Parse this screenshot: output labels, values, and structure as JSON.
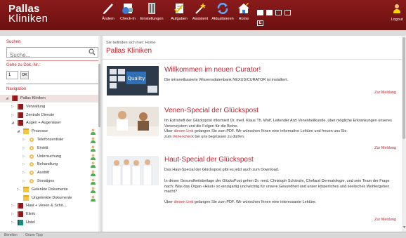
{
  "app": {
    "logo_line1": "Pallas",
    "logo_line2": "Kliniken"
  },
  "toolbar": {
    "items": [
      {
        "label": "Ändern",
        "icon": "pencil-icon"
      },
      {
        "label": "Check-In",
        "icon": "check-in-icon"
      },
      {
        "label": "Einstellungen",
        "icon": "settings-icon"
      },
      {
        "label": "Aufgaben",
        "icon": "tasks-icon"
      },
      {
        "label": "Assistent",
        "icon": "wizard-icon"
      },
      {
        "label": "Aktualisieren",
        "icon": "refresh-icon"
      },
      {
        "label": "Home",
        "icon": "home-icon"
      }
    ],
    "layout_e": "E",
    "logout_label": "Logout"
  },
  "sidebar": {
    "search_label": "Suchen",
    "search_placeholder": "Suche...",
    "docnr_label": "Gehe zu Dok.-Nr.:",
    "docnr_value": "1",
    "ok_label": "OK",
    "nav_label": "Navigation",
    "tree": [
      {
        "label": "Pallas Kliniken",
        "icon": "book-red",
        "level": 0,
        "arrow": "◢",
        "selected": true,
        "user": false
      },
      {
        "label": "Verwaltung",
        "icon": "book-red",
        "level": 1,
        "arrow": "▷",
        "user": false
      },
      {
        "label": "Zentrale Dienste",
        "icon": "book-red",
        "level": 1,
        "arrow": "▷",
        "user": false
      },
      {
        "label": "Augen + Augenlaser",
        "icon": "book-red",
        "level": 1,
        "arrow": "◢",
        "user": false
      },
      {
        "label": "Prozesse",
        "icon": "folder",
        "level": 2,
        "arrow": "◢",
        "user": true
      },
      {
        "label": "Telefonzentrale",
        "icon": "gear",
        "level": 3,
        "arrow": "▷",
        "user": true
      },
      {
        "label": "Eintritt",
        "icon": "gear",
        "level": 3,
        "arrow": "▷",
        "user": true
      },
      {
        "label": "Untersuchung",
        "icon": "gear",
        "level": 3,
        "arrow": "▷",
        "user": true
      },
      {
        "label": "Behandlung",
        "icon": "gear",
        "level": 3,
        "arrow": "▷",
        "user": true
      },
      {
        "label": "Austritt",
        "icon": "gear",
        "level": 3,
        "arrow": "▷",
        "user": true
      },
      {
        "label": "Sonstiges",
        "icon": "gear",
        "level": 3,
        "arrow": "▷",
        "user": true
      },
      {
        "label": "Gelenkte Dokumente",
        "icon": "folder",
        "level": 2,
        "arrow": "▷",
        "user": true
      },
      {
        "label": "Ungelenkte Dokumente",
        "icon": "folder",
        "level": 2,
        "arrow": "",
        "user": true
      },
      {
        "label": "Haut + Venen & Schö...",
        "icon": "book-red",
        "level": 1,
        "arrow": "▷",
        "user": false
      },
      {
        "label": "Klinik",
        "icon": "book-red",
        "level": 1,
        "arrow": "▷",
        "user": false
      },
      {
        "label": "Hotel",
        "icon": "book-teal",
        "level": 1,
        "arrow": "▷",
        "user": false
      }
    ]
  },
  "main": {
    "breadcrumb": "Sie befinden sich hier: Home",
    "title": "Pallas Kliniken",
    "articles": [
      {
        "heading": "Willkommen im neuen Curator!",
        "paragraphs": [
          "Die intranetbasierte Wissensdatenbank NEXUS/CURATOR ist installiert."
        ],
        "more": "Zur Meldung",
        "thumb": "keyboard-quality"
      },
      {
        "heading": "Venen-Special der Glückspost",
        "p1": "Im Extraheft der Glückspost informiert Dr. med. Klaus Th. Wolf, Leitender Arzt Venenheilkunde, über mögliche Erkrankungen unseres Venensystem und die Folgen für die Beine.",
        "p2_pre": "Über ",
        "p2_link": "diesen Link",
        "p2_post": " gelangen Sie zum PDF. Wir wünschen Ihnen eine informative Lektüre und freuen uns Sie",
        "p3_pre": "zum ",
        "p3_link": "Venencheck",
        "p3_post": " bei uns begrüssen zu dürfen.",
        "more": "Zur Meldung",
        "thumb": "doctor-consultation"
      },
      {
        "heading": "Haut-Special der Glückspost",
        "p1": "Das Haut-Special der Glückspost gibt es jetzt auch zum Download.",
        "p2": "In dieser Gesundheitsbeilage der GlücksPost gehen Dr. med. Christoph Schänzle, Chefarzt Dermatologie, und sein Team der Frage nach: Was das Organ «Haut» so einzigartig und wichtig für unsere Gesundheit und unser körperliches und seelisches Wohlergehen macht?",
        "p3_pre": "Über ",
        "p3_link": "diesen Link",
        "p3_post": " gelangen Sie zum PDF. Wir wünschen Ihnen eine interessante Lektüre.",
        "more": "Zur Meldung",
        "thumb": "medical-team"
      }
    ]
  },
  "statusbar": {
    "left": "Bereiten",
    "right": "Gruen Tipp"
  },
  "colors": {
    "header": "#7a1414",
    "accent": "#c6202a"
  }
}
